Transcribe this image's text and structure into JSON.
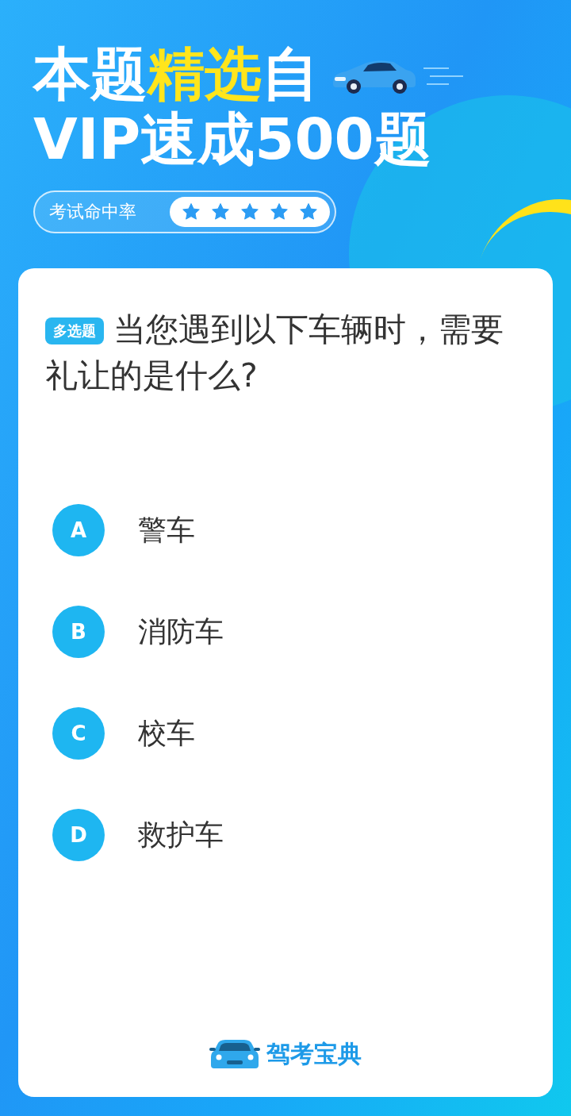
{
  "header": {
    "title_lines": [
      [
        {
          "text": "本题",
          "highlight": false
        },
        {
          "text": "精选",
          "highlight": true
        },
        {
          "text": "自",
          "highlight": false
        }
      ],
      [
        {
          "text": "VIP速成500题",
          "highlight": false
        }
      ]
    ],
    "rating": {
      "label": "考试命中率",
      "stars": 5
    }
  },
  "question": {
    "type_badge": "多选题",
    "text": "当您遇到以下车辆时，需要礼让的是什么?",
    "options": [
      {
        "letter": "A",
        "text": "警车"
      },
      {
        "letter": "B",
        "text": "消防车"
      },
      {
        "letter": "C",
        "text": "校车"
      },
      {
        "letter": "D",
        "text": "救护车"
      }
    ]
  },
  "brand": {
    "name": "驾考宝典"
  }
}
